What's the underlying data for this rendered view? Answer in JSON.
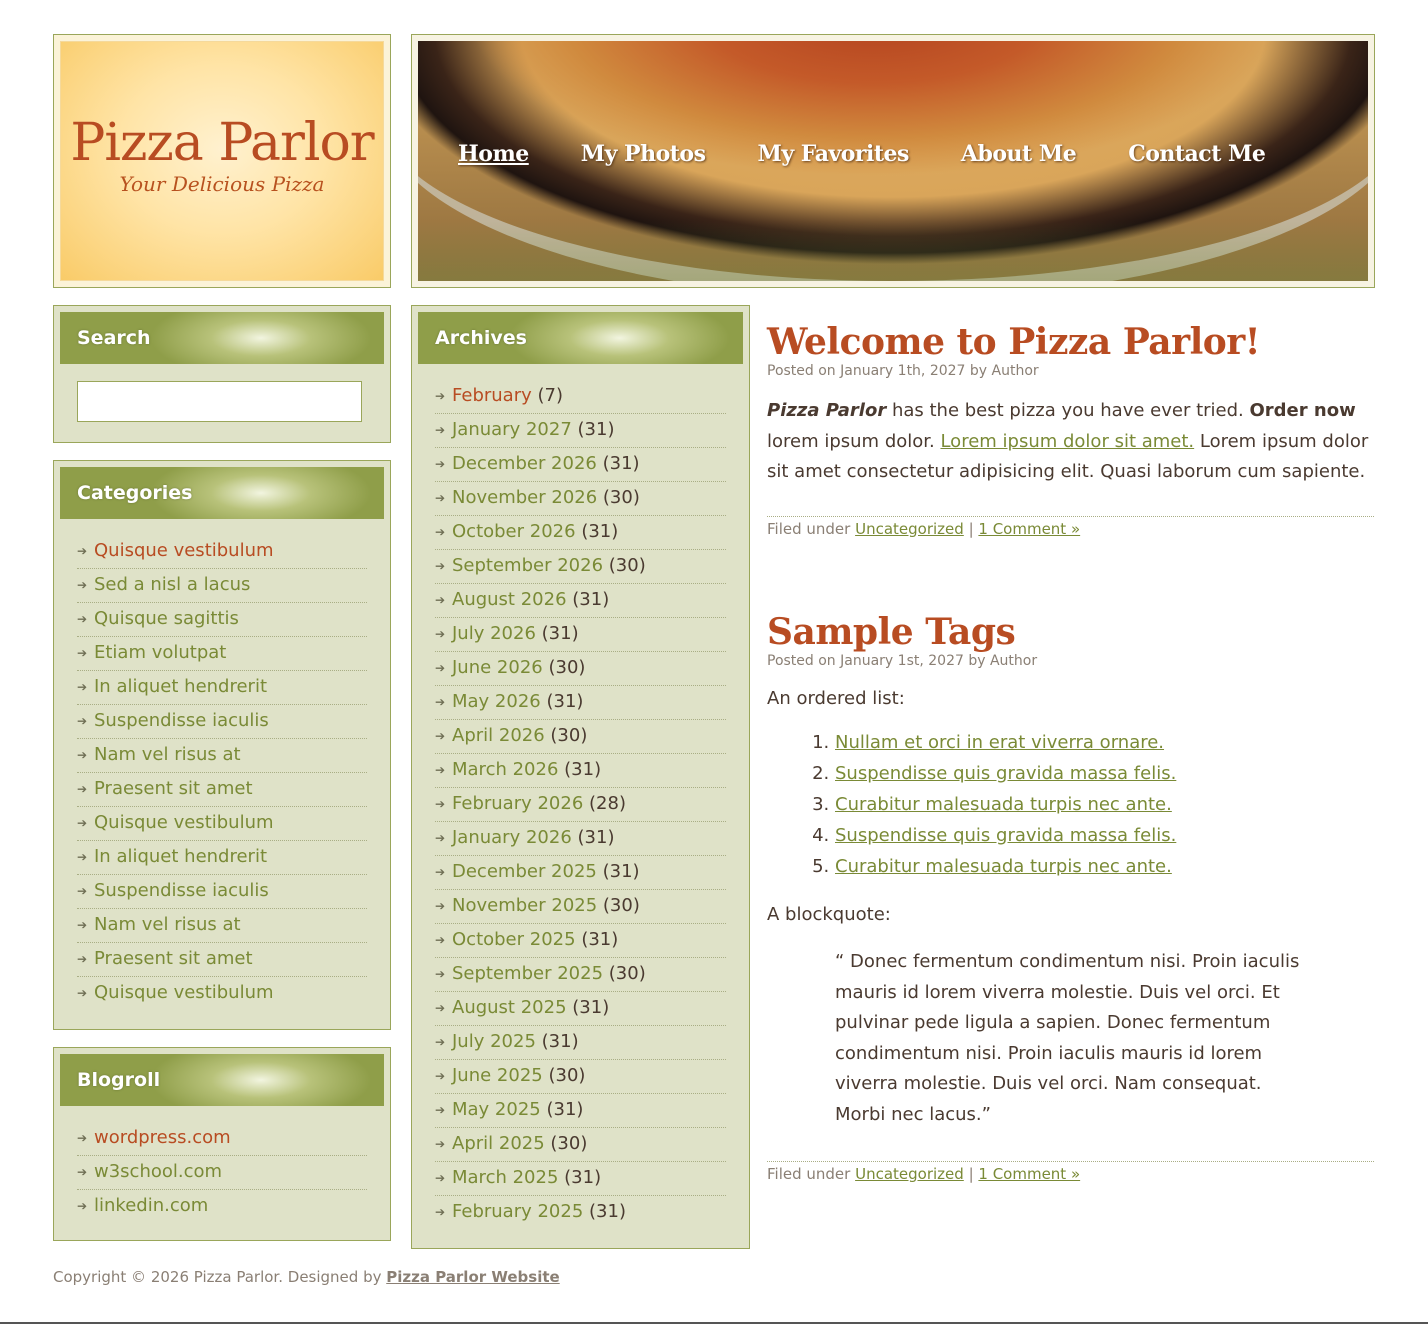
{
  "header": {
    "site_title": "Pizza Parlor",
    "tagline": "Your Delicious Pizza",
    "nav": [
      {
        "label": "Home",
        "active": true
      },
      {
        "label": "My Photos"
      },
      {
        "label": "My Favorites"
      },
      {
        "label": "About Me"
      },
      {
        "label": "Contact Me"
      }
    ]
  },
  "search": {
    "title": "Search",
    "value": ""
  },
  "categories": {
    "title": "Categories",
    "items": [
      "Quisque vestibulum",
      "Sed a nisl a lacus",
      "Quisque sagittis",
      "Etiam volutpat",
      "In aliquet hendrerit",
      "Suspendisse iaculis",
      "Nam vel risus at",
      "Praesent sit amet",
      "Quisque vestibulum",
      "In aliquet hendrerit",
      "Suspendisse iaculis",
      "Nam vel risus at",
      "Praesent sit amet",
      "Quisque vestibulum"
    ]
  },
  "blogroll": {
    "title": "Blogroll",
    "items": [
      "wordpress.com",
      "w3school.com",
      "linkedin.com"
    ]
  },
  "archives": {
    "title": "Archives",
    "items": [
      {
        "label": "February",
        "count": "(7)"
      },
      {
        "label": "January 2027",
        "count": "(31)"
      },
      {
        "label": "December 2026",
        "count": "(31)"
      },
      {
        "label": "November 2026",
        "count": "(30)"
      },
      {
        "label": "October 2026",
        "count": "(31)"
      },
      {
        "label": "September 2026",
        "count": "(30)"
      },
      {
        "label": "August 2026",
        "count": "(31)"
      },
      {
        "label": "July 2026",
        "count": "(31)"
      },
      {
        "label": "June 2026",
        "count": "(30)"
      },
      {
        "label": "May 2026",
        "count": "(31)"
      },
      {
        "label": "April 2026",
        "count": "(30)"
      },
      {
        "label": "March 2026",
        "count": "(31)"
      },
      {
        "label": "February 2026",
        "count": "(28)"
      },
      {
        "label": "January 2026",
        "count": "(31)"
      },
      {
        "label": "December 2025",
        "count": "(31)"
      },
      {
        "label": "November 2025",
        "count": "(30)"
      },
      {
        "label": "October 2025",
        "count": "(31)"
      },
      {
        "label": "September 2025",
        "count": "(30)"
      },
      {
        "label": "August 2025",
        "count": "(31)"
      },
      {
        "label": "July 2025",
        "count": "(31)"
      },
      {
        "label": "June 2025",
        "count": "(30)"
      },
      {
        "label": "May 2025",
        "count": "(31)"
      },
      {
        "label": "April 2025",
        "count": "(30)"
      },
      {
        "label": "March 2025",
        "count": "(31)"
      },
      {
        "label": "February 2025",
        "count": "(31)"
      }
    ]
  },
  "posts": [
    {
      "title": "Welcome to Pizza Parlor!",
      "meta_prefix": "Posted on ",
      "date": "January 1th, 2027",
      "meta_by": " by ",
      "author": "Author",
      "body": {
        "brand": "Pizza Parlor",
        "text1": " has the best pizza you have ever tried. ",
        "bold": "Order now",
        "text2": " lorem ipsum dolor. ",
        "link": "Lorem ipsum dolor sit amet.",
        "text3": " Lorem ipsum dolor sit amet consectetur adipisicing elit. Quasi laborum cum sapiente."
      },
      "footer": {
        "filed": "Filed under ",
        "category": "Uncategorized",
        "sep": " | ",
        "comments": "1 Comment »"
      }
    },
    {
      "title": "Sample Tags",
      "meta_prefix": "Posted on ",
      "date": "January 1st, 2027",
      "meta_by": " by ",
      "author": "Author",
      "list_intro": "An ordered list:",
      "list_items": [
        "Nullam et orci in erat viverra ornare.",
        "Suspendisse quis gravida massa felis.",
        "Curabitur malesuada turpis nec ante.",
        "Suspendisse quis gravida massa felis.",
        "Curabitur malesuada turpis nec ante."
      ],
      "quote_intro": "A blockquote:",
      "quote": "“ Donec fermentum condimentum nisi. Proin iaculis mauris id lorem viverra molestie. Duis vel orci. Et pulvinar pede ligula a sapien. Donec fermentum condimentum nisi. Proin iaculis mauris id lorem viverra molestie. Duis vel orci. Nam consequat. Morbi nec lacus.”",
      "footer": {
        "filed": "Filed under ",
        "category": "Uncategorized",
        "sep": " | ",
        "comments": "1 Comment »"
      }
    }
  ],
  "footer": {
    "copyright": "Copyright © 2026 Pizza Parlor. Designed by ",
    "designer_link": "Pizza Parlor Website"
  },
  "colors": {
    "accent": "#b84c22",
    "link_green": "#7a8a36",
    "widget_bg": "#dfe2c8",
    "border": "#9aa65a"
  }
}
